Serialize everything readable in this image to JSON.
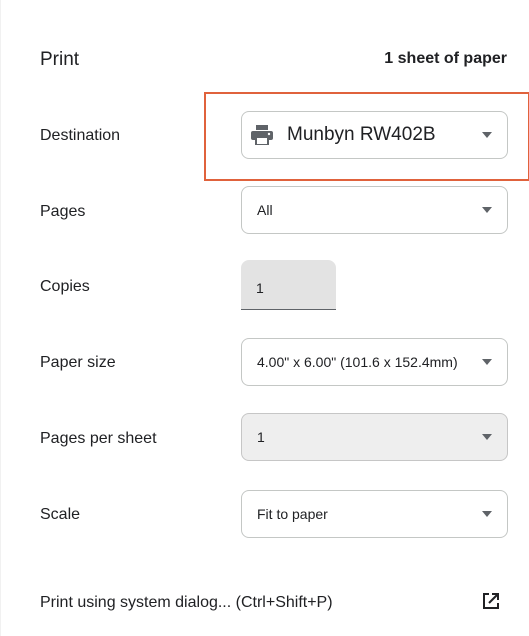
{
  "header": {
    "title": "Print",
    "sheet_count": "1 sheet of paper"
  },
  "rows": {
    "destination": {
      "label": "Destination",
      "value": "Munbyn RW402B",
      "icon": "printer-icon"
    },
    "pages": {
      "label": "Pages",
      "value": "All"
    },
    "copies": {
      "label": "Copies",
      "value": "1"
    },
    "paper_size": {
      "label": "Paper size",
      "value": "4.00\" x 6.00\" (101.6 x 152.4mm)"
    },
    "pages_per_sheet": {
      "label": "Pages per sheet",
      "value": "1"
    },
    "scale": {
      "label": "Scale",
      "value": "Fit to paper"
    }
  },
  "footer": {
    "system_dialog_label": "Print using system dialog... (Ctrl+Shift+P)",
    "icon": "open-in-new-icon"
  },
  "colors": {
    "highlight": "#e0623c",
    "text": "#202124",
    "border": "#c4c7c5",
    "disabled_bg": "#eeeeee"
  }
}
